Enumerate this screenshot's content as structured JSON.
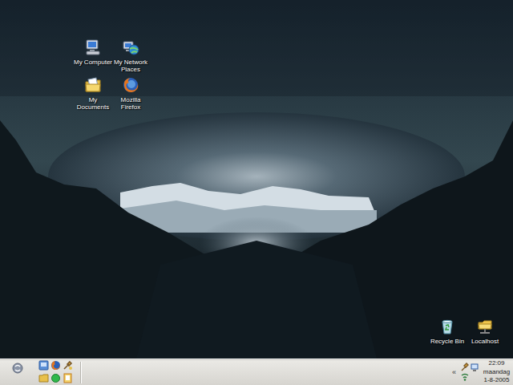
{
  "desktop": {
    "icons": [
      {
        "label": "My Computer"
      },
      {
        "label": "My Network Places"
      },
      {
        "label": "My Documents"
      },
      {
        "label": "Mozilla Firefox"
      },
      {
        "label": "Recycle Bin"
      },
      {
        "label": "Localhost"
      }
    ]
  },
  "taskbar": {
    "tray": {
      "expand": "«",
      "time": "22:09",
      "day": "maandag",
      "date": "1-8-2005"
    }
  }
}
